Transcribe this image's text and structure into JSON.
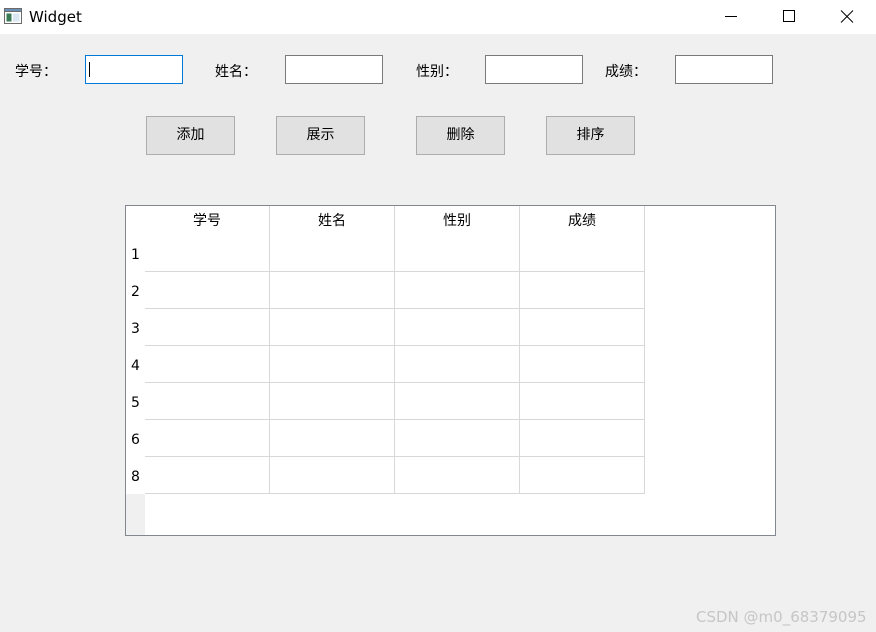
{
  "window": {
    "title": "Widget",
    "icon": "window-icon",
    "controls": [
      "minimize-icon",
      "maximize-icon",
      "close-icon"
    ]
  },
  "form": {
    "id_label": "学号：",
    "name_label": "姓名：",
    "gender_label": "性别：",
    "score_label": "成绩：",
    "id_value": "",
    "name_value": "",
    "gender_value": "",
    "score_value": ""
  },
  "buttons": {
    "add": "添加",
    "show": "展示",
    "delete": "删除",
    "sort": "排序"
  },
  "table": {
    "columns": [
      "学号",
      "姓名",
      "性别",
      "成绩"
    ],
    "row_headers": [
      "1",
      "2",
      "3",
      "4",
      "5",
      "6",
      "8"
    ],
    "rows": [
      [
        "",
        "",
        "",
        ""
      ],
      [
        "",
        "",
        "",
        ""
      ],
      [
        "",
        "",
        "",
        ""
      ],
      [
        "",
        "",
        "",
        ""
      ],
      [
        "",
        "",
        "",
        ""
      ],
      [
        "",
        "",
        "",
        ""
      ],
      [
        "",
        "",
        "",
        ""
      ]
    ]
  },
  "watermark": "CSDN @m0_68379095",
  "colors": {
    "focus_border": "#0078d7",
    "window_bg": "#f0f0f0",
    "button_bg": "#e1e1e1"
  }
}
